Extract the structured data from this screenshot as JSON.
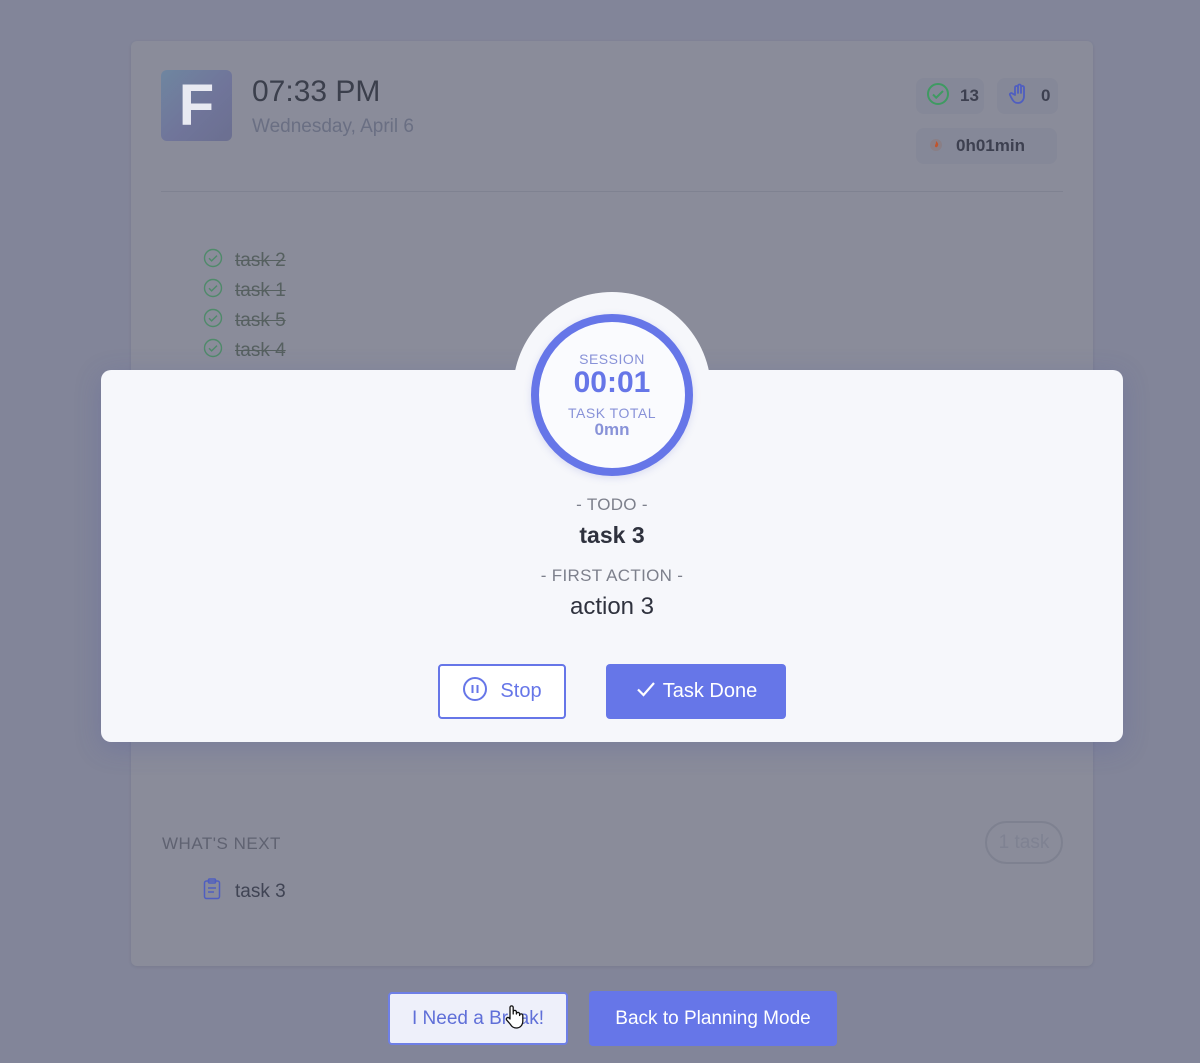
{
  "header": {
    "logo_letter": "F",
    "time": "07:33 PM",
    "date": "Wednesday, April 6"
  },
  "stats": {
    "completed_count": "13",
    "interruptions_count": "0",
    "focus_time": "0h01min"
  },
  "done_tasks": [
    "task 2",
    "task 1",
    "task 5",
    "task 4"
  ],
  "timer": {
    "session_label": "SESSION",
    "session_value": "00:01",
    "task_total_label": "TASK TOTAL",
    "task_total_value": "0mn"
  },
  "current": {
    "todo_label": "- TODO -",
    "todo_value": "task 3",
    "first_action_label": "- FIRST ACTION -",
    "first_action_value": "action 3"
  },
  "buttons": {
    "stop": "Stop",
    "task_done": "Task Done",
    "need_break": "I Need a Break!",
    "back_planning": "Back to Planning Mode"
  },
  "next": {
    "heading": "WHAT'S NEXT",
    "badge": "1 task",
    "items": [
      "task 3"
    ]
  },
  "colors": {
    "accent": "#6676e8",
    "overlay": "#828599",
    "check_green": "#4fae6f"
  }
}
